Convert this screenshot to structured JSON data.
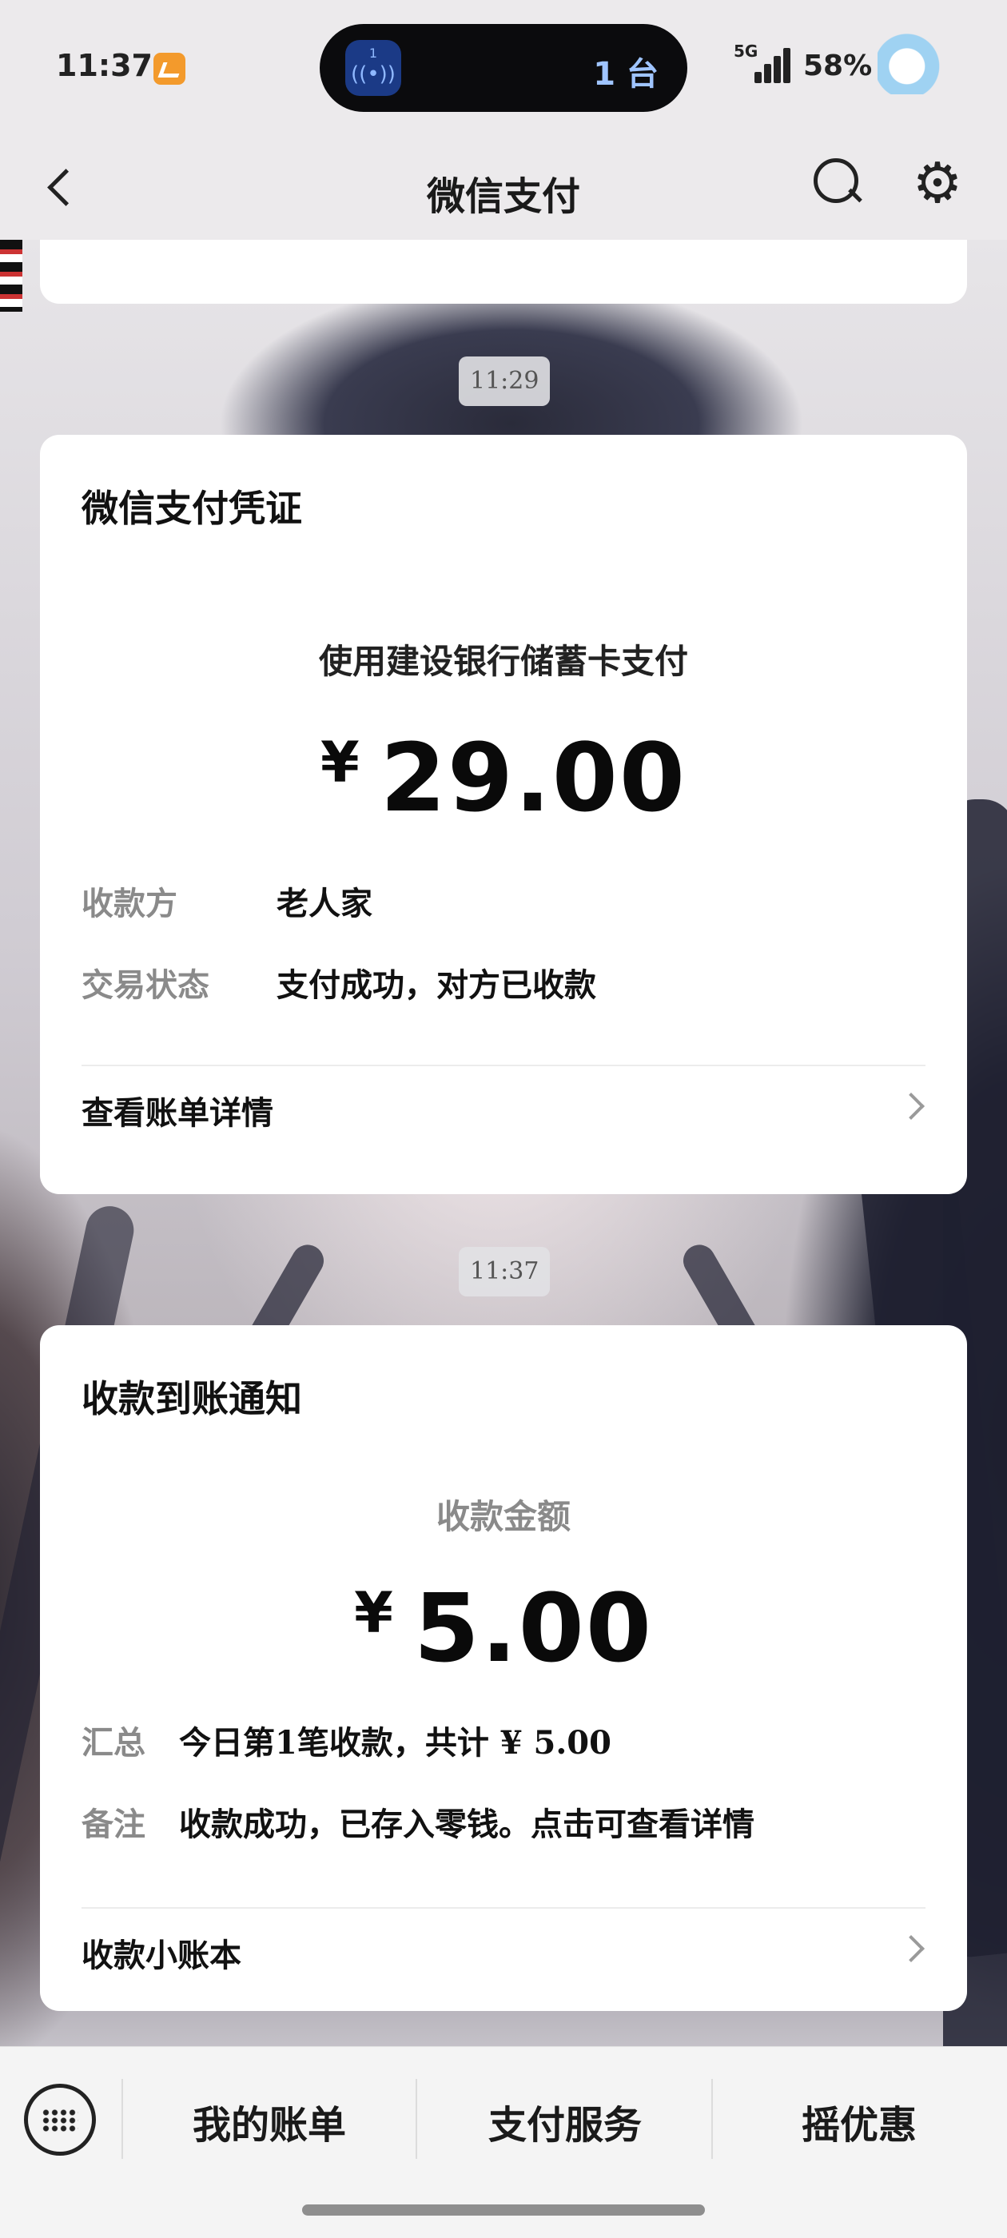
{
  "status_bar": {
    "time": "11:37",
    "island_text": "1 台",
    "island_badge": "1",
    "network": "5G",
    "battery": "58%"
  },
  "nav": {
    "title": "微信支付"
  },
  "messages": [
    {
      "time": "11:29",
      "title": "微信支付凭证",
      "subtitle": "使用建设银行储蓄卡支付",
      "currency": "¥",
      "amount": "29.00",
      "rows": [
        {
          "label": "收款方",
          "value": "老人家"
        },
        {
          "label": "交易状态",
          "value": "支付成功，对方已收款"
        }
      ],
      "link": "查看账单详情"
    },
    {
      "time": "11:37",
      "title": "收款到账通知",
      "subtitle": "收款金额",
      "currency": "¥",
      "amount": "5.00",
      "rows": [
        {
          "label": "汇总",
          "value": "今日第1笔收款，共计 ¥ 5.00"
        },
        {
          "label": "备注",
          "value": "收款成功，已存入零钱。点击可查看详情"
        }
      ],
      "link": "收款小账本"
    }
  ],
  "bottom_menu": {
    "items": [
      "我的账单",
      "支付服务",
      "摇优惠"
    ]
  },
  "icons": {
    "back": "back-arrow-icon",
    "search": "search-icon",
    "settings": "gear-icon",
    "keyboard": "keyboard-icon"
  }
}
